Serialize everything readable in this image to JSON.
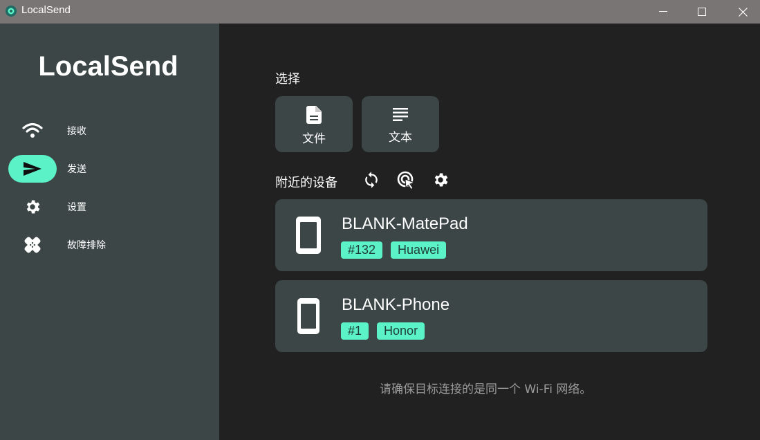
{
  "window": {
    "title": "LocalSend"
  },
  "sidebar": {
    "brand": "LocalSend",
    "items": [
      {
        "label": "接收",
        "icon": "wifi-icon"
      },
      {
        "label": "发送",
        "icon": "send-icon",
        "active": true
      },
      {
        "label": "设置",
        "icon": "gear-icon"
      },
      {
        "label": "故障排除",
        "icon": "bandage-icon"
      }
    ]
  },
  "main": {
    "selection_label": "选择",
    "selection_buttons": [
      {
        "label": "文件",
        "icon": "file-icon"
      },
      {
        "label": "文本",
        "icon": "text-icon"
      }
    ],
    "nearby_label": "附近的设备",
    "toolbar_icons": [
      "refresh-icon",
      "tap-target-icon",
      "gear-icon"
    ],
    "devices": [
      {
        "name": "BLANK-MatePad",
        "tags": [
          "#132",
          "Huawei"
        ],
        "icon": "tablet-icon"
      },
      {
        "name": "BLANK-Phone",
        "tags": [
          "#1",
          "Honor"
        ],
        "icon": "phone-icon"
      }
    ],
    "hint": "请确保目标连接的是同一个 Wi-Fi 网络。"
  },
  "colors": {
    "accent": "#5cf2c8",
    "sidebar_bg": "#3c4646",
    "main_bg": "#212121",
    "titlebar_bg": "#7a7575"
  }
}
